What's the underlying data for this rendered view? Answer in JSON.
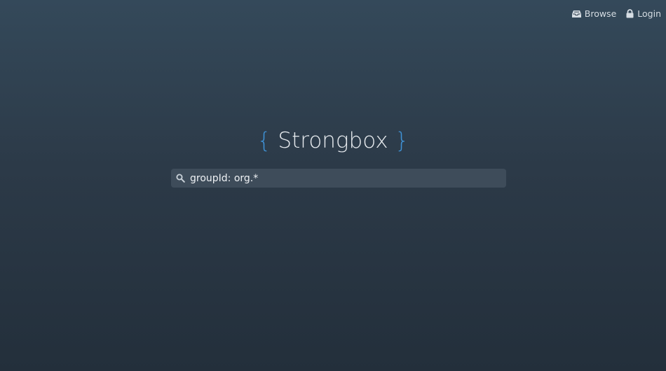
{
  "nav": {
    "browse_label": "Browse",
    "login_label": "Login",
    "browse_icon": "inbox-icon",
    "login_icon": "lock-icon"
  },
  "logo": {
    "open_brace": "{",
    "name": "Strongbox",
    "close_brace": "}"
  },
  "search": {
    "value": "groupId: org.*",
    "icon": "search-icon"
  },
  "colors": {
    "accent": "#3f92d6",
    "background_top": "#34495a",
    "background_bottom": "#232f3b"
  }
}
